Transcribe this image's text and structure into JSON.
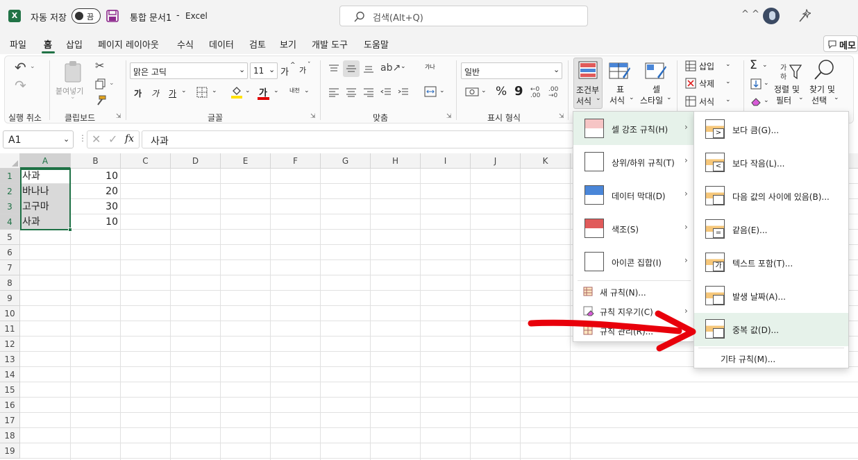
{
  "titlebar": {
    "autosave_label": "자동 저장",
    "autosave_state": "끔",
    "doc_title": "통합 문서1",
    "sep": "-",
    "app_name": "Excel",
    "search_placeholder": "검색(Alt+Q)",
    "collapse": "^ ^"
  },
  "tabs": [
    "파일",
    "홈",
    "삽입",
    "페이지 레이아웃",
    "수식",
    "데이터",
    "검토",
    "보기",
    "개발 도구",
    "도움말"
  ],
  "memo_button": "메모",
  "ribbon": {
    "groups": {
      "undo": "실행 취소",
      "clipboard": "클립보드",
      "font": "글꼴",
      "align": "맞춤",
      "number": "표시 형식"
    },
    "paste_label": "붙여넣기",
    "font_name": "맑은 고딕",
    "font_size": "11",
    "font_grow": "가",
    "font_shrink": "가",
    "bold": "가",
    "italic": "가",
    "underline": "가",
    "font_color": "가",
    "phonetic": "내천",
    "wrap_text": "갸나",
    "number_format": "일반",
    "percent": "%",
    "comma": "9",
    "cond_format_line1": "조건부",
    "cond_format_line2": "서식",
    "table_line1": "표",
    "table_line2": "서식",
    "cell_style_line1": "셀",
    "cell_style_line2": "스타일",
    "insert": "삽입",
    "delete": "삭제",
    "format": "서식",
    "sort_filter_line1": "정렬 및",
    "sort_filter_line2": "필터",
    "find_select_line1": "찾기 및",
    "find_select_line2": "선택"
  },
  "formula_bar": {
    "name_box": "A1",
    "fx": "fx",
    "content": "사과"
  },
  "columns": [
    "A",
    "B",
    "C",
    "D",
    "E",
    "F",
    "G",
    "H",
    "I",
    "J",
    "K"
  ],
  "rows": [
    "1",
    "2",
    "3",
    "4",
    "5",
    "6",
    "7",
    "8",
    "9",
    "10",
    "11",
    "12",
    "13",
    "14",
    "15",
    "16",
    "17",
    "18",
    "19"
  ],
  "cells": {
    "A1": "사과",
    "A2": "바나나",
    "A3": "고구마",
    "A4": "사과",
    "B1": "10",
    "B2": "20",
    "B3": "30",
    "B4": "10"
  },
  "cf_menu": {
    "items": [
      {
        "label": "셀 강조 규칙(H)"
      },
      {
        "label": "상위/하위 규칙(T)"
      },
      {
        "label": "데이터 막대(D)"
      },
      {
        "label": "색조(S)"
      },
      {
        "label": "아이콘 집합(I)"
      }
    ],
    "new_rule": "새 규칙(N)...",
    "clear_rules": "규칙 지우기(C)",
    "manage_rules": "규칙 관리(R)..."
  },
  "submenu": {
    "items": [
      {
        "label": "보다 큼(G)...",
        "glyph": ">"
      },
      {
        "label": "보다 작음(L)...",
        "glyph": "<"
      },
      {
        "label": "다음 값의 사이에 있음(B)...",
        "glyph": ""
      },
      {
        "label": "같음(E)...",
        "glyph": "="
      },
      {
        "label": "텍스트 포함(T)...",
        "glyph": "가"
      },
      {
        "label": "발생 날짜(A)...",
        "glyph": ""
      },
      {
        "label": "중복 값(D)...",
        "glyph": ""
      }
    ],
    "more_rules": "기타 규칙(M)..."
  },
  "colors": {
    "excel_green": "#217346",
    "annotation_arrow": "#e8000b",
    "highlight": "#e6f2ea",
    "selection_border": "#1e7145"
  }
}
